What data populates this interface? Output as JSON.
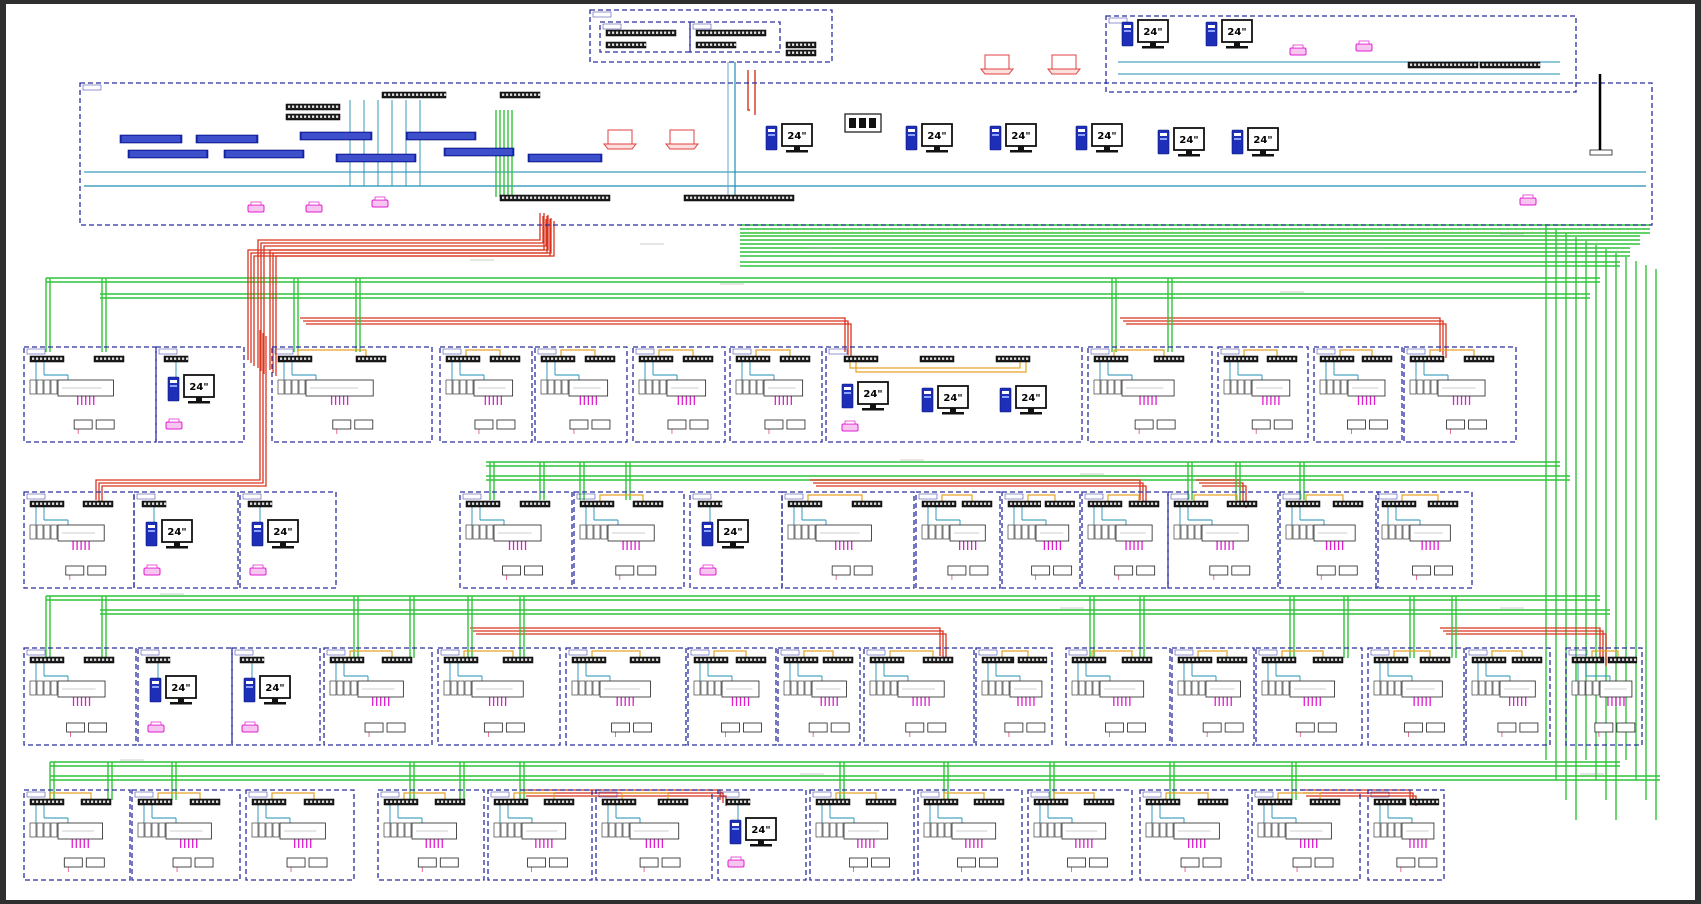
{
  "diagram": {
    "monitor_label": "24\"",
    "colors": {
      "border": "#2b2ea0",
      "device_blue": "#1d2fb8",
      "fiber_green": "#31c43a",
      "copper_red": "#d9341f",
      "patch_orange": "#e7a22a",
      "cyan": "#1f8fb5",
      "printer_magenta": "#e21bd1",
      "laptop_red": "#e04040"
    },
    "icons": [
      "switch-icon",
      "server-icon",
      "workstation-icon",
      "monitor-icon",
      "printer-icon",
      "laptop-icon",
      "router-icon"
    ]
  }
}
